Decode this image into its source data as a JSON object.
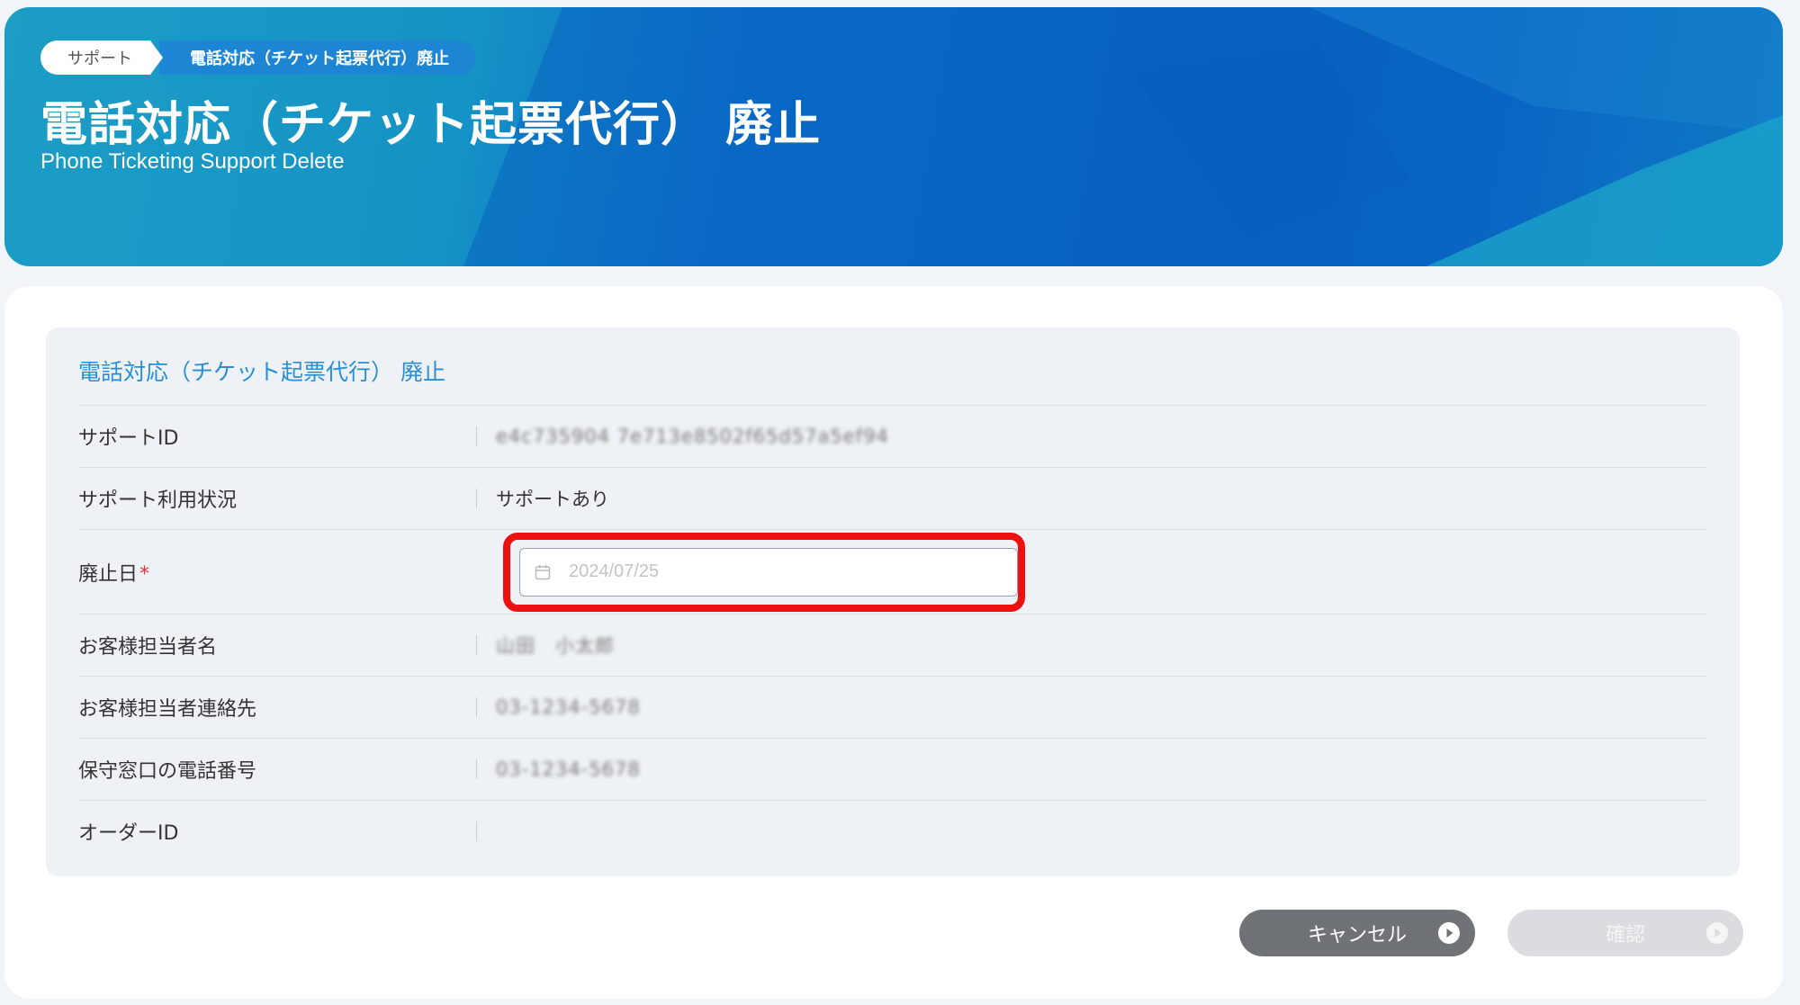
{
  "header": {
    "breadcrumb": [
      "サポート",
      "電話対応（チケット起票代行）廃止"
    ],
    "title": "電話対応（チケット起票代行） 廃止",
    "subtitle": "Phone Ticketing Support Delete"
  },
  "form": {
    "section_title": "電話対応（チケット起票代行） 廃止",
    "fields": [
      {
        "label": "サポートID",
        "value": "e4c735904 7e713e8502f65d57a5ef94",
        "blurred": true
      },
      {
        "label": "サポート利用状況",
        "value": "サポートあり"
      },
      {
        "label": "廃止日",
        "required_mark": "*",
        "placeholder": "2024/07/25"
      },
      {
        "label": "お客様担当者名",
        "value": "山田　小太郎",
        "blurred": true
      },
      {
        "label": "お客様担当者連絡先",
        "value": "03-1234-5678",
        "blurred": true
      },
      {
        "label": "保守窓口の電話番号",
        "value": "03-1234-5678",
        "blurred": true
      },
      {
        "label": "オーダーID",
        "value": ""
      }
    ]
  },
  "buttons": {
    "cancel": "キャンセル",
    "confirm": "確認"
  },
  "colors": {
    "accent": "#2a8fd0",
    "highlight": "#ee1111",
    "required": "#e5323b"
  }
}
